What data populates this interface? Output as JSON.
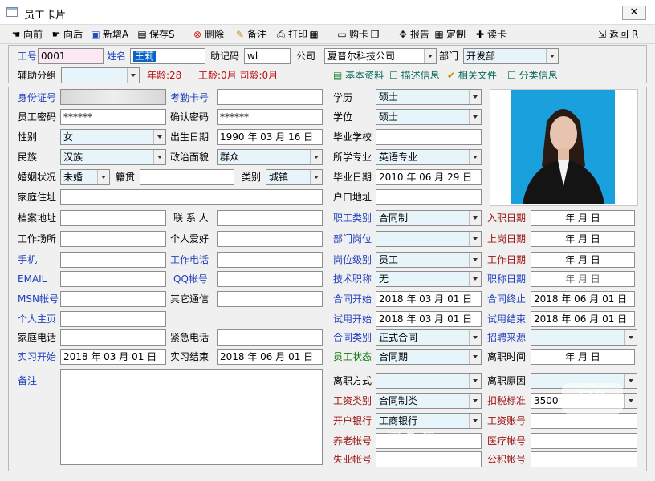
{
  "window": {
    "title": "员工卡片",
    "close": "✕"
  },
  "toolbar": {
    "prev": "向前",
    "next": "向后",
    "add": "新增A",
    "save": "保存S",
    "delete": "删除",
    "backup": "备注",
    "print": "打印",
    "card_read": "购卡",
    "report": "报告",
    "custom": "定制",
    "read_card": "读卡",
    "back": "返回 R"
  },
  "header": {
    "emp_no_label": "工号",
    "emp_no": "0001",
    "name_label": "姓名",
    "name": "王莉",
    "mnemonic_label": "助记码",
    "mnemonic": "wl",
    "company_label": "公司",
    "company": "夏普尔科技公司",
    "dept_label": "部门",
    "dept": "开发部",
    "aux_group_label": "辅助分组",
    "aux_group": "",
    "age_text": "年龄:28",
    "seniority_text": "工龄:0月 司龄:0月",
    "tab_basic": "基本资料",
    "tab_desc": "描述信息",
    "tab_files": "相关文件",
    "tab_class": "分类信息"
  },
  "left": {
    "id_card_label": "身份证号",
    "id_card": "",
    "attend_card_label": "考勤卡号",
    "attend_card": "",
    "emp_pwd_label": "员工密码",
    "emp_pwd": "******",
    "confirm_pwd_label": "确认密码",
    "confirm_pwd": "******",
    "gender_label": "性别",
    "gender": "女",
    "birth_label": "出生日期",
    "birth": "1990 年 03 月 16 日",
    "nation_label": "民族",
    "nation": "汉族",
    "politics_label": "政治面貌",
    "politics": "群众",
    "marriage_label": "婚姻状况",
    "marriage": "未婚",
    "native_label": "籍贯",
    "native": "",
    "category_label": "类别",
    "category": "城镇",
    "home_addr_label": "家庭住址",
    "home_addr": "",
    "archive_addr_label": "档案地址",
    "archive_addr": "",
    "contact_label": "联 系 人",
    "contact": "",
    "workplace_label": "工作场所",
    "workplace": "",
    "hobby_label": "个人爱好",
    "hobby": "",
    "mobile_label": "手机",
    "mobile": "",
    "work_phone_label": "工作电话",
    "work_phone": "",
    "email_label": "EMAIL",
    "email": "",
    "qq_label": "QQ帐号",
    "qq": "",
    "msn_label": "MSN帐号",
    "msn": "",
    "other_label": "其它通信",
    "other": "",
    "homepage_label": "个人主页",
    "homepage": "",
    "home_phone_label": "家庭电话",
    "home_phone": "",
    "emergency_label": "紧急电话",
    "emergency": "",
    "intern_start_label": "实习开始",
    "intern_start": "2018 年 03 月 01 日",
    "intern_end_label": "实习结束",
    "intern_end": "2018 年 06 月 01 日",
    "remark_label": "备注",
    "remark": ""
  },
  "mid": {
    "edu_label": "学历",
    "edu": "硕士",
    "degree_label": "学位",
    "degree": "硕士",
    "school_label": "毕业学校",
    "school": "",
    "major_label": "所学专业",
    "major": "英语专业",
    "grad_date_label": "毕业日期",
    "grad_date": "2010 年 06 月 29 日",
    "hukou_label": "户口地址",
    "hukou": "",
    "emp_type_label": "职工类别",
    "emp_type": "合同制",
    "dept_post_label": "部门岗位",
    "dept_post": "",
    "post_level_label": "岗位级别",
    "post_level": "员工",
    "title_label": "技术职称",
    "title": "无",
    "contract_start_label": "合同开始",
    "contract_start": "2018 年 03 月 01 日",
    "trial_start_label": "试用开始",
    "trial_start": "2018 年 03 月 01 日",
    "contract_type_label": "合同类别",
    "contract_type": "正式合同",
    "emp_status_label": "员工状态",
    "emp_status": "合同期",
    "leave_way_label": "离职方式",
    "leave_way": "",
    "salary_type_label": "工资类别",
    "salary_type": "合同制类",
    "bank_label": "开户银行",
    "bank": "工商银行",
    "pension_label": "养老帐号",
    "pension": "",
    "unemploy_label": "失业帐号",
    "unemploy": ""
  },
  "right": {
    "entry_date_label": "入职日期",
    "entry_date": "年  月  日",
    "post_date_label": "上岗日期",
    "post_date": "年  月  日",
    "work_date_label": "工作日期",
    "work_date": "年  月  日",
    "title_date_label": "职称日期",
    "title_date": "年  月  日",
    "contract_end_label": "合同终止",
    "contract_end": "2018 年 06 月 01 日",
    "trial_end_label": "试用结束",
    "trial_end": "2018 年 06 月 01 日",
    "recruit_label": "招聘来源",
    "recruit": "",
    "leave_time_label": "离职时间",
    "leave_time": "年  月  日",
    "leave_reason_label": "离职原因",
    "leave_reason": "",
    "tax_label": "扣税标准",
    "tax": "3500",
    "salary_acc_label": "工资账号",
    "salary_acc": "",
    "medical_label": "医疗帐号",
    "medical": "",
    "fund_label": "公积帐号",
    "fund": ""
  },
  "watermark": {
    "text": "闲鱼号：",
    "logo": "闲鱼"
  }
}
